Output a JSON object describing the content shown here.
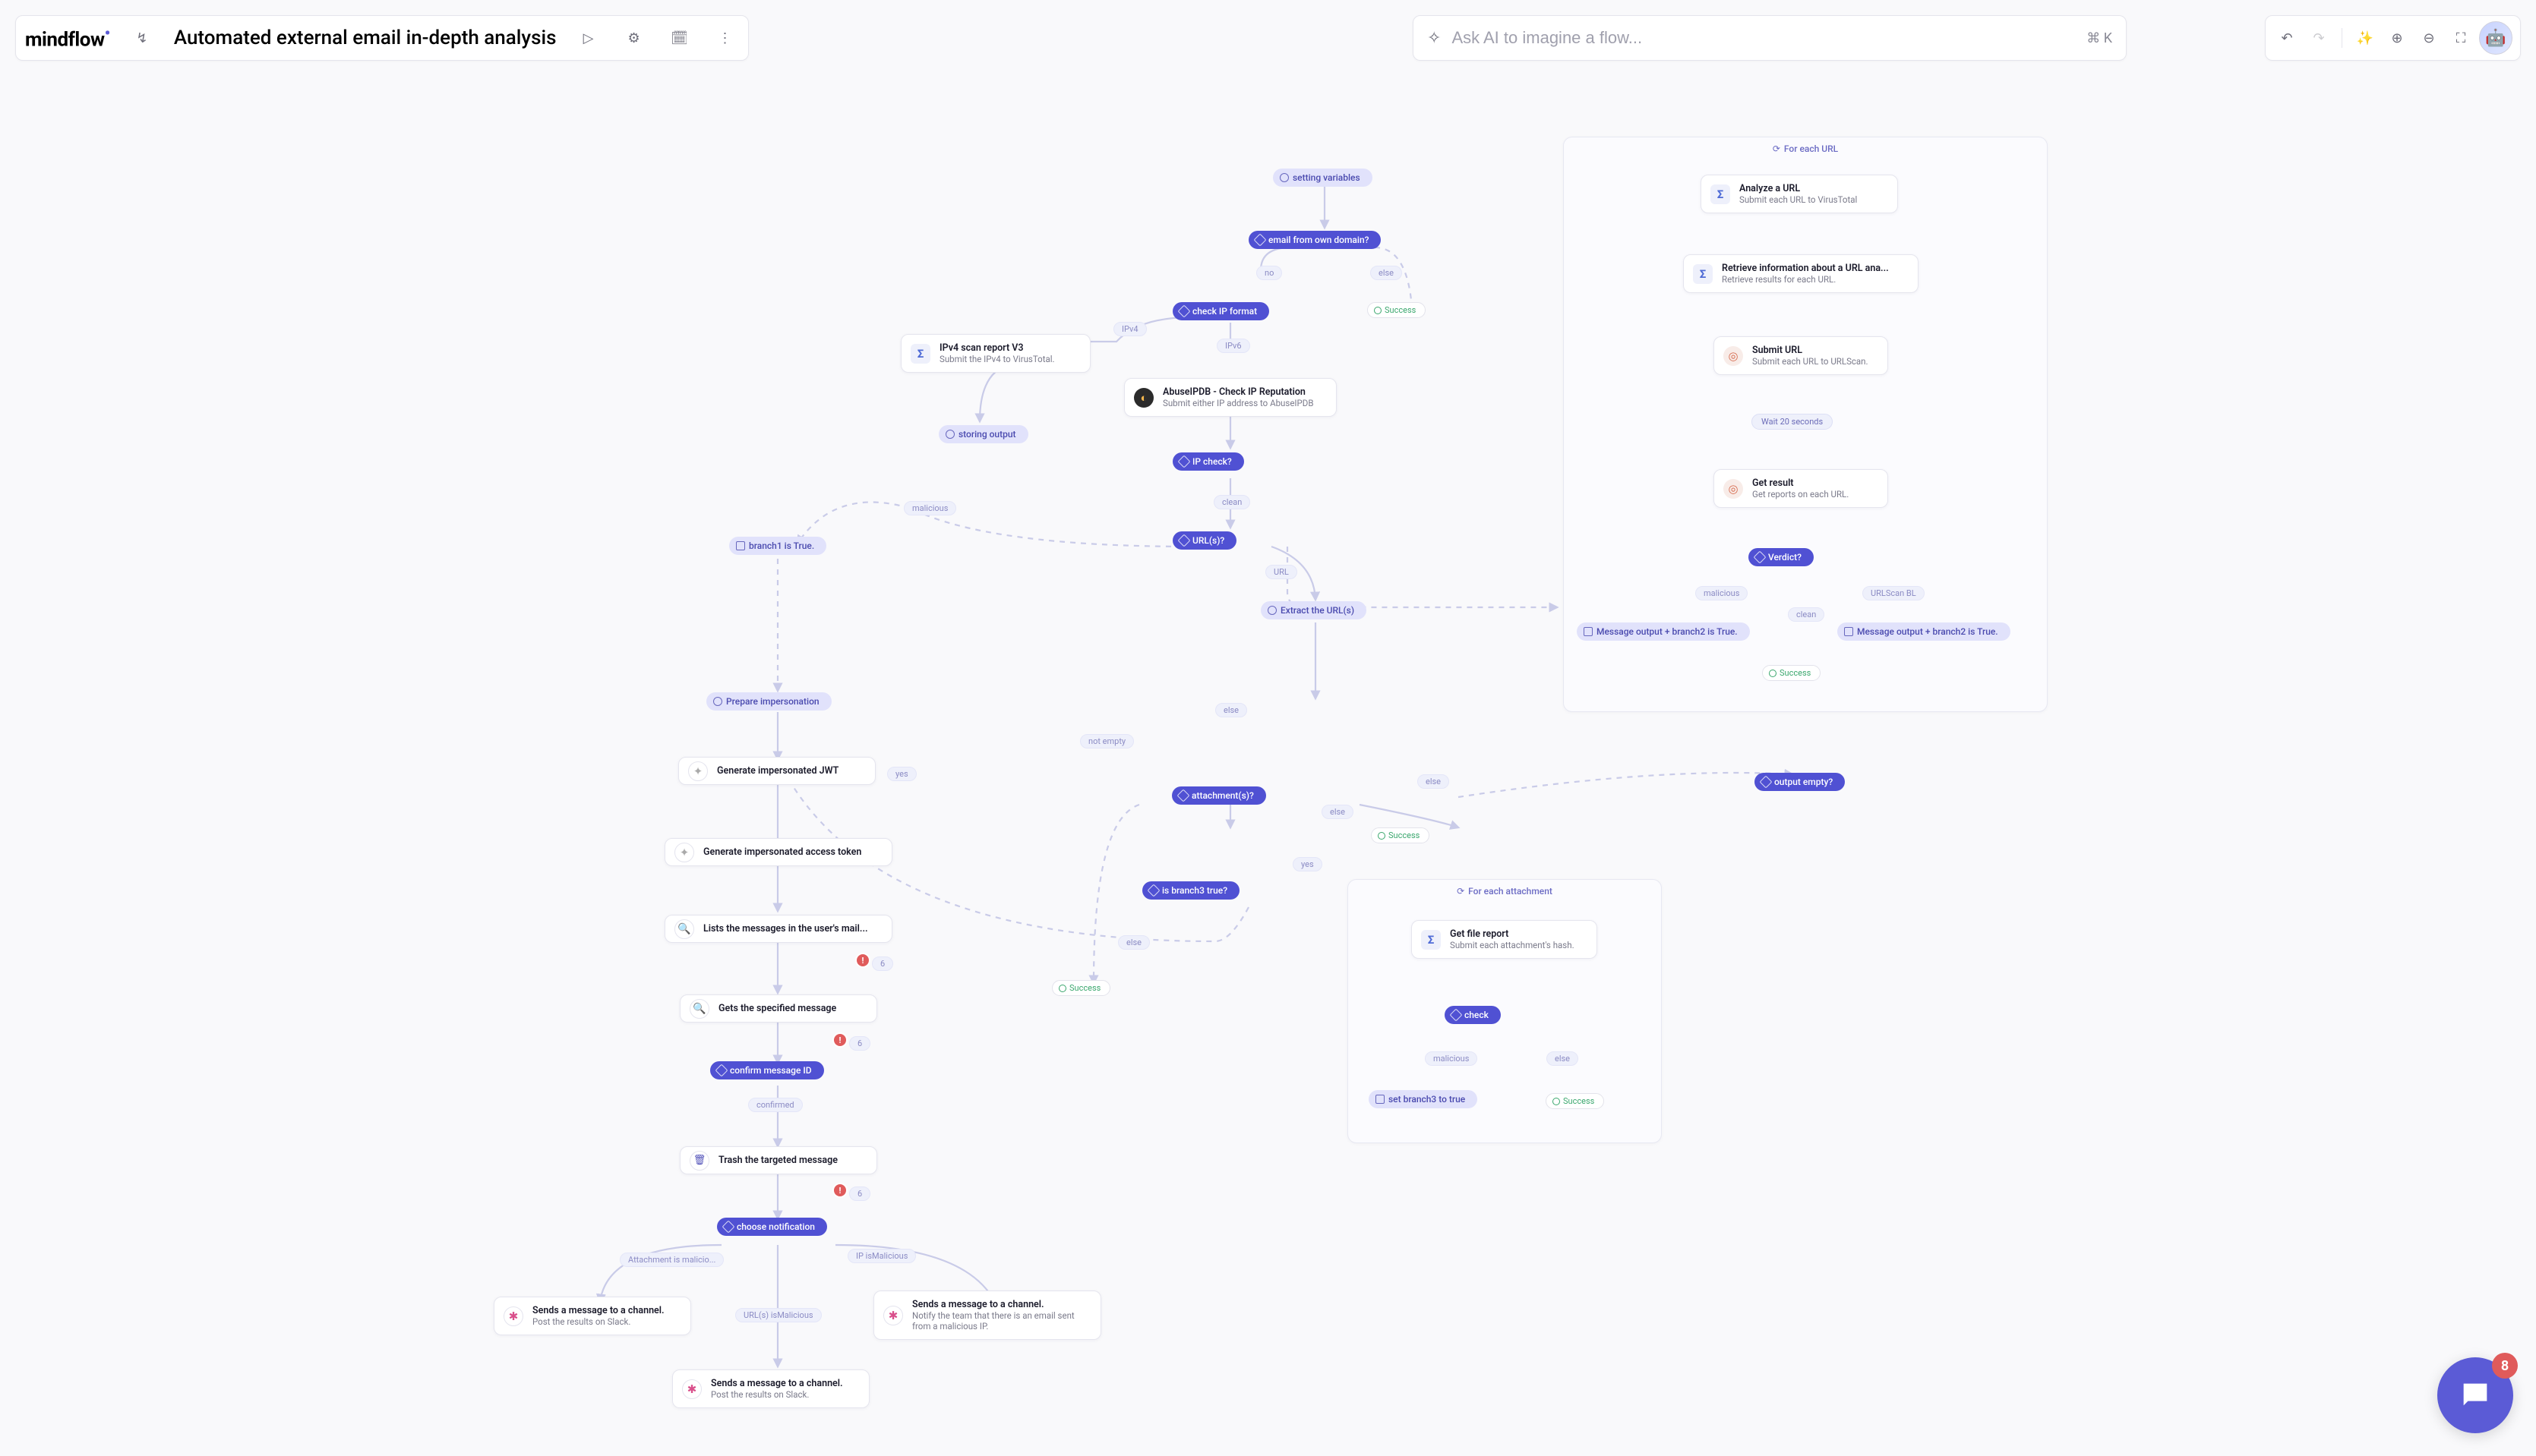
{
  "header": {
    "brand": "mindflow",
    "flow_title": "Automated external email in-depth analysis"
  },
  "ai": {
    "placeholder": "Ask AI to imagine a flow...",
    "shortcut": "⌘ K"
  },
  "intercom_badge": "8",
  "labels": {
    "no": "no",
    "else": "else",
    "ipv4": "IPv4",
    "ipv6": "IPv6",
    "malicious": "malicious",
    "clean": "clean",
    "url": "URL",
    "yes": "yes",
    "not_empty": "not empty",
    "confirmed": "confirmed",
    "attach_mal": "Attachment is malicio...",
    "ip_mal": "IP isMalicious",
    "url_mal": "URL(s) isMalicious",
    "urlscan_bl": "URLScan BL"
  },
  "nodes": {
    "setvars": "setting variables",
    "own_domain": "email from own domain?",
    "check_ip_fmt": "check IP format",
    "ipv4_scan_t": "IPv4 scan report V3",
    "ipv4_scan_s": "Submit the IPv4 to VirusTotal.",
    "storing": "storing output",
    "abuse_t": "AbuseIPDB - Check IP Reputation",
    "abuse_s": "Submit either IP address to AbuseIPDB",
    "ip_check": "IP check?",
    "branch1": "branch1 is True.",
    "urls_q": "URL(s)?",
    "extract_urls": "Extract the URL(s)",
    "prep_imp": "Prepare impersonation",
    "jwt": "Generate impersonated JWT",
    "token": "Generate impersonated access token",
    "list_msgs": "Lists the messages in the user's mail...",
    "get_msg": "Gets the specified message",
    "confirm_id": "confirm message ID",
    "trash": "Trash the targeted message",
    "choose_notif": "choose notification",
    "slack1_t": "Sends a message to a channel.",
    "slack1_s": "Post the results on Slack.",
    "slack2_t": "Sends a message to a channel.",
    "slack2_s": "Post the results on Slack.",
    "slack3_t": "Sends a message to a channel.",
    "slack3_s": "Notify the team that there is an email sent from a malicious IP.",
    "attach_q": "attachment(s)?",
    "is_b3": "is branch3 true?",
    "output_empty": "output empty?",
    "success": "Success",
    "for_each_url": "For each URL",
    "analyze_url_t": "Analyze a URL",
    "analyze_url_s": "Submit each URL to VirusTotal",
    "retrieve_url_t": "Retrieve information about a URL ana...",
    "retrieve_url_s": "Retrieve results for each URL.",
    "submit_url_t": "Submit URL",
    "submit_url_s": "Submit each URL to URLScan.",
    "wait20": "Wait 20 seconds",
    "get_result_t": "Get result",
    "get_result_s": "Get reports on each URL.",
    "verdict": "Verdict?",
    "msg_out_b2_a": "Message output + branch2 is True.",
    "msg_out_b2_b": "Message output + branch2 is True.",
    "for_each_attach": "For each attachment",
    "file_report_t": "Get file report",
    "file_report_s": "Submit each attachment's hash.",
    "check": "check",
    "set_b3": "set branch3 to true"
  }
}
